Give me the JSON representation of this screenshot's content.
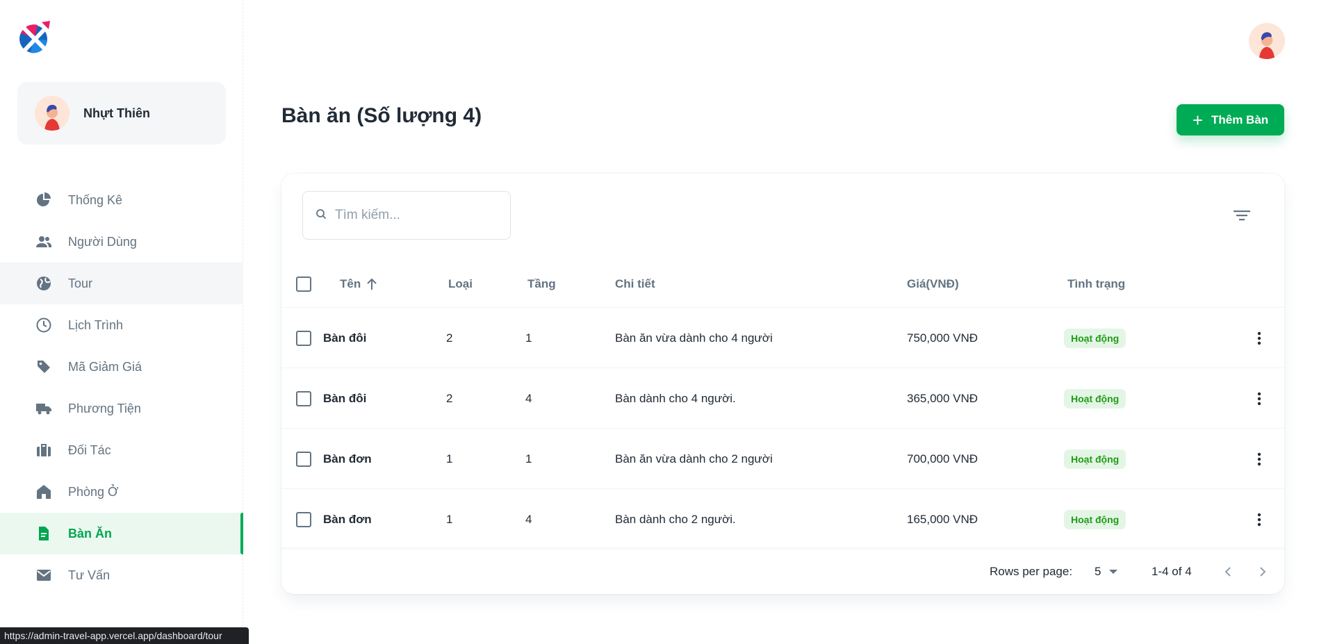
{
  "sidebar": {
    "account_name": "Nhựt Thiên",
    "items": [
      {
        "label": "Thống Kê",
        "icon": "pie-chart-icon"
      },
      {
        "label": "Người Dùng",
        "icon": "people-icon"
      },
      {
        "label": "Tour",
        "icon": "globe-icon"
      },
      {
        "label": "Lịch Trình",
        "icon": "clock-icon"
      },
      {
        "label": "Mã Giảm Giá",
        "icon": "tag-icon"
      },
      {
        "label": "Phương Tiện",
        "icon": "truck-icon"
      },
      {
        "label": "Đối Tác",
        "icon": "briefcase-icon"
      },
      {
        "label": "Phòng Ở",
        "icon": "home-icon"
      },
      {
        "label": "Bàn Ăn",
        "icon": "document-icon"
      },
      {
        "label": "Tư Vấn",
        "icon": "mail-icon"
      }
    ],
    "active_index": 8,
    "hover_index": 2
  },
  "page": {
    "title": "Bàn ăn (Số lượng 4)",
    "add_button": "Thêm Bàn"
  },
  "search": {
    "placeholder": "Tìm kiếm..."
  },
  "table": {
    "headers": {
      "name": "Tên",
      "type": "Loại",
      "floor": "Tầng",
      "detail": "Chi tiết",
      "price": "Giá(VNĐ)",
      "status": "Tình trạng"
    },
    "rows": [
      {
        "name": "Bàn đôi",
        "type": "2",
        "floor": "1",
        "detail": "Bàn ăn vừa dành cho 4 người",
        "price": "750,000 VNĐ",
        "status": "Hoạt động"
      },
      {
        "name": "Bàn đôi",
        "type": "2",
        "floor": "4",
        "detail": "Bàn dành cho 4 người.",
        "price": "365,000 VNĐ",
        "status": "Hoạt động"
      },
      {
        "name": "Bàn đơn",
        "type": "1",
        "floor": "1",
        "detail": "Bàn ăn vừa dành cho 2 người",
        "price": "700,000 VNĐ",
        "status": "Hoạt động"
      },
      {
        "name": "Bàn đơn",
        "type": "1",
        "floor": "4",
        "detail": "Bàn dành cho 2 người.",
        "price": "165,000 VNĐ",
        "status": "Hoạt động"
      }
    ]
  },
  "pagination": {
    "rows_per_page_label": "Rows per page:",
    "rows_per_page": "5",
    "range": "1-4 of 4"
  },
  "status_url": "https://admin-travel-app.vercel.app/dashboard/tour",
  "colors": {
    "primary": "#00ab55",
    "active_bg": "#ebf8f0",
    "badge_bg": "#e3f6e6",
    "badge_text": "#229a16"
  }
}
